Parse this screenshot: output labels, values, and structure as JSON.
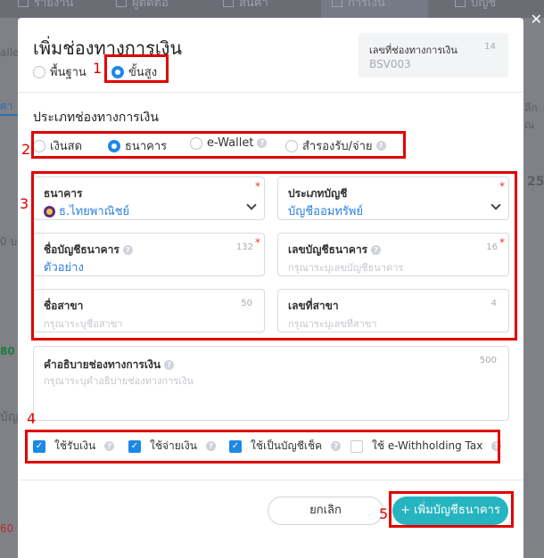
{
  "background": {
    "tabs": [
      "รายงาน",
      "ผู้ติดต่อ",
      "สินค้า",
      "การเงิน",
      "บัญชี"
    ],
    "side_texts": [
      "allet",
      "ศา",
      "0 บา",
      "80 บ",
      "บัญ",
      "60 บ"
    ],
    "right_texts": [
      "ลึก ณ",
      "25"
    ]
  },
  "modal": {
    "title": "เพิ่มช่องทางการเงิน",
    "mode_options": [
      {
        "label": "พื้นฐาน",
        "checked": false
      },
      {
        "label": "ขั้นสูง",
        "checked": true
      }
    ],
    "code": {
      "label": "เลขที่ช่องทางการเงิน",
      "count": "14",
      "value": "BSV003"
    },
    "type_section_title": "ประเภทช่องทางการเงิน",
    "type_options": [
      {
        "label": "เงินสด",
        "checked": false
      },
      {
        "label": "ธนาคาร",
        "checked": true
      },
      {
        "label": "e-Wallet",
        "checked": false
      },
      {
        "label": "สำรองรับ/จ่าย",
        "checked": false
      }
    ],
    "fields": {
      "bank": {
        "label": "ธนาคาร",
        "value": "ธ.ไทยพาณิชย์"
      },
      "account_type": {
        "label": "ประเภทบัญชี",
        "value": "บัญชีออมทรัพย์"
      },
      "account_name": {
        "label": "ชื่อบัญชีธนาคาร",
        "count": "132",
        "value": "ตัวอย่าง"
      },
      "account_number": {
        "label": "เลขบัญชีธนาคาร",
        "count": "16",
        "placeholder": "กรุณาระบุเลขบัญชีธนาคาร"
      },
      "branch_name": {
        "label": "ชื่อสาขา",
        "count": "50",
        "placeholder": "กรุณาระบุชื่อสาขา"
      },
      "branch_number": {
        "label": "เลขที่สาขา",
        "count": "4",
        "placeholder": "กรุณาระบุเลขที่สาขา"
      },
      "description": {
        "label": "คำอธิบายช่องทางการเงิน",
        "count": "500",
        "placeholder": "กรุณาระบุคำอธิบายช่องทางการเงิน"
      }
    },
    "checkboxes": [
      {
        "label": "ใช้รับเงิน",
        "checked": true
      },
      {
        "label": "ใช้จ่ายเงิน",
        "checked": true
      },
      {
        "label": "ใช้เป็นบัญชีเช็ค",
        "checked": true
      },
      {
        "label": "ใช้ e-Withholding Tax",
        "checked": false
      }
    ],
    "buttons": {
      "cancel": "ยกเลิก",
      "add": "+ เพิ่มบัญชีธนาคาร"
    }
  },
  "annotations": [
    "1",
    "2",
    "3",
    "4",
    "5"
  ],
  "colors": {
    "primary": "#1e88e5",
    "accent": "#26b5c0",
    "annotation": "#e00000",
    "link": "#2b7de0"
  }
}
